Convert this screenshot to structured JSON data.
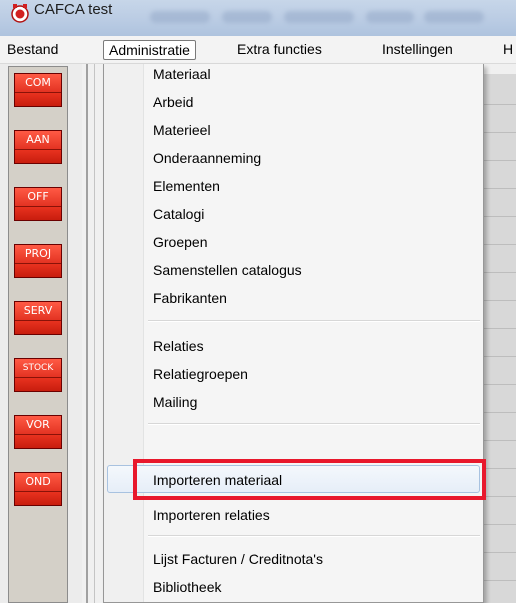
{
  "window": {
    "title": "CAFCA test",
    "icon": "cafca-app-icon"
  },
  "menubar": {
    "items": [
      {
        "label": "Bestand"
      },
      {
        "label": "Administratie"
      },
      {
        "label": "Extra functies"
      },
      {
        "label": "Instellingen"
      },
      {
        "label": "H"
      }
    ],
    "open_menu": "Administratie"
  },
  "toolbar": {
    "buttons": [
      {
        "label": "COM"
      },
      {
        "label": "AAN"
      },
      {
        "label": "OFF"
      },
      {
        "label": "PROJ"
      },
      {
        "label": "SERV"
      },
      {
        "label": "STOCK"
      },
      {
        "label": "VOR"
      },
      {
        "label": "OND"
      }
    ],
    "button_color": "#e02a1a"
  },
  "dropdown": {
    "groups": [
      {
        "items": [
          {
            "label": "Materiaal"
          },
          {
            "label": "Arbeid"
          },
          {
            "label": "Materieel"
          },
          {
            "label": "Onderaanneming"
          },
          {
            "label": "Elementen"
          },
          {
            "label": "Catalogi"
          },
          {
            "label": "Groepen"
          },
          {
            "label": "Samenstellen catalogus"
          },
          {
            "label": "Fabrikanten"
          }
        ]
      },
      {
        "items": [
          {
            "label": "Relaties"
          },
          {
            "label": "Relatiegroepen"
          },
          {
            "label": "Mailing"
          }
        ]
      },
      {
        "items": [
          {
            "label": "Importeren materiaal"
          },
          {
            "label": "Importeren relaties"
          }
        ]
      },
      {
        "items": [
          {
            "label": "Lijst Facturen / Creditnota's"
          },
          {
            "label": "Bibliotheek"
          }
        ]
      }
    ],
    "hovered_item": "Importeren materiaal",
    "highlight_color": "#e8182c"
  }
}
